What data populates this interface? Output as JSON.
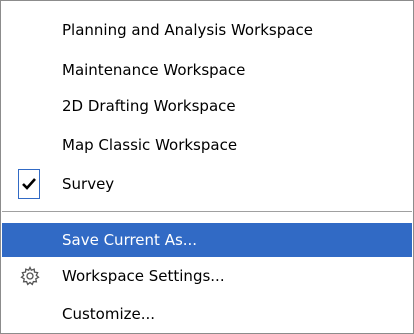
{
  "menu": {
    "items": [
      {
        "label": "Planning and Analysis Workspace"
      },
      {
        "label": "Maintenance Workspace"
      },
      {
        "label": "2D Drafting Workspace"
      },
      {
        "label": "Map Classic Workspace"
      },
      {
        "label": "Survey",
        "checked": true,
        "icon": "check-icon"
      }
    ],
    "actions": [
      {
        "label": "Save Current As...",
        "selected": true
      },
      {
        "label": "Workspace Settings...",
        "icon": "gear-icon"
      },
      {
        "label": "Customize..."
      }
    ],
    "colors": {
      "highlight": "#316ac5",
      "highlight_text": "#ffffff",
      "border": "#8c8c8c",
      "separator": "#a0a0a0"
    }
  }
}
